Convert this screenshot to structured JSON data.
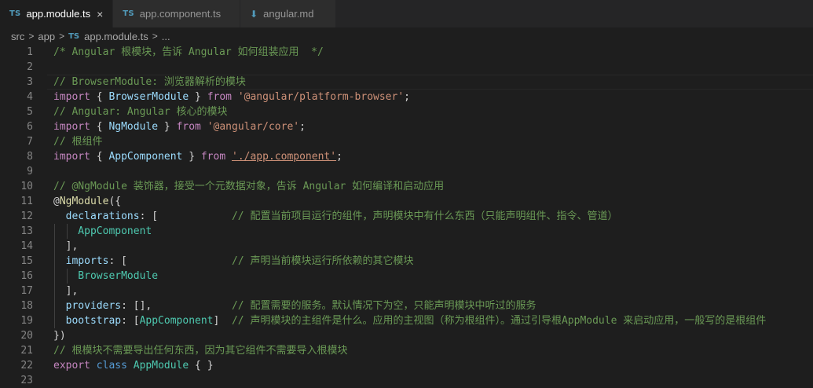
{
  "tabs": [
    {
      "icon": "TS",
      "label": "app.module.ts",
      "close": "×",
      "active": true
    },
    {
      "icon": "TS",
      "label": "app.component.ts",
      "active": false
    },
    {
      "icon": "⬇",
      "label": "angular.md",
      "active": false
    }
  ],
  "breadcrumb": {
    "parts": [
      "src",
      "app"
    ],
    "file_icon": "TS",
    "file": "app.module.ts",
    "more": "...",
    "sep": ">"
  },
  "editor": {
    "lines": [
      {
        "n": "1",
        "tokens": [
          {
            "t": "/* Angular 根模块，告诉 Angular 如何组装应用  */",
            "c": "c"
          }
        ]
      },
      {
        "n": "2",
        "tokens": []
      },
      {
        "n": "3",
        "tokens": [
          {
            "t": "// BrowserModule: 浏览器解析的模块",
            "c": "c"
          }
        ]
      },
      {
        "n": "4",
        "tokens": [
          {
            "t": "import",
            "c": "k"
          },
          {
            "t": " { ",
            "c": "p"
          },
          {
            "t": "BrowserModule",
            "c": "v"
          },
          {
            "t": " } ",
            "c": "p"
          },
          {
            "t": "from",
            "c": "k"
          },
          {
            "t": " ",
            "c": "p"
          },
          {
            "t": "'@angular/platform-browser'",
            "c": "s"
          },
          {
            "t": ";",
            "c": "p"
          }
        ]
      },
      {
        "n": "5",
        "tokens": [
          {
            "t": "// Angular: Angular 核心的模块",
            "c": "c"
          }
        ]
      },
      {
        "n": "6",
        "tokens": [
          {
            "t": "import",
            "c": "k"
          },
          {
            "t": " { ",
            "c": "p"
          },
          {
            "t": "NgModule",
            "c": "v"
          },
          {
            "t": " } ",
            "c": "p"
          },
          {
            "t": "from",
            "c": "k"
          },
          {
            "t": " ",
            "c": "p"
          },
          {
            "t": "'@angular/core'",
            "c": "s"
          },
          {
            "t": ";",
            "c": "p"
          }
        ]
      },
      {
        "n": "7",
        "tokens": [
          {
            "t": "// 根组件",
            "c": "c"
          }
        ]
      },
      {
        "n": "8",
        "tokens": [
          {
            "t": "import",
            "c": "k"
          },
          {
            "t": " { ",
            "c": "p"
          },
          {
            "t": "AppComponent",
            "c": "v"
          },
          {
            "t": " } ",
            "c": "p"
          },
          {
            "t": "from",
            "c": "k"
          },
          {
            "t": " ",
            "c": "p"
          },
          {
            "t": "'./app.component'",
            "c": "s u"
          },
          {
            "t": ";",
            "c": "p"
          }
        ]
      },
      {
        "n": "9",
        "tokens": []
      },
      {
        "n": "10",
        "tokens": [
          {
            "t": "// @NgModule 装饰器，接受一个元数据对象，告诉 Angular 如何编译和启动应用",
            "c": "c"
          }
        ]
      },
      {
        "n": "11",
        "tokens": [
          {
            "t": "@",
            "c": "p"
          },
          {
            "t": "NgModule",
            "c": "dec"
          },
          {
            "t": "({",
            "c": "p"
          }
        ]
      },
      {
        "n": "12",
        "tokens": [
          {
            "t": "  declarations",
            "c": "v"
          },
          {
            "t": ": [            ",
            "c": "p"
          },
          {
            "t": "// 配置当前项目运行的组件，声明模块中有什么东西（只能声明组件、指令、管道）",
            "c": "c"
          }
        ]
      },
      {
        "n": "13",
        "tokens": [
          {
            "t": "    AppComponent",
            "c": "t"
          }
        ]
      },
      {
        "n": "14",
        "tokens": [
          {
            "t": "  ],",
            "c": "p"
          }
        ]
      },
      {
        "n": "15",
        "tokens": [
          {
            "t": "  imports",
            "c": "v"
          },
          {
            "t": ": [                 ",
            "c": "p"
          },
          {
            "t": "// 声明当前模块运行所依赖的其它模块",
            "c": "c"
          }
        ]
      },
      {
        "n": "16",
        "tokens": [
          {
            "t": "    BrowserModule",
            "c": "t"
          }
        ]
      },
      {
        "n": "17",
        "tokens": [
          {
            "t": "  ],",
            "c": "p"
          }
        ]
      },
      {
        "n": "18",
        "tokens": [
          {
            "t": "  providers",
            "c": "v"
          },
          {
            "t": ": [],             ",
            "c": "p"
          },
          {
            "t": "// 配置需要的服务。默认情况下为空，只能声明模块中听过的服务",
            "c": "c"
          }
        ]
      },
      {
        "n": "19",
        "tokens": [
          {
            "t": "  bootstrap",
            "c": "v"
          },
          {
            "t": ": [",
            "c": "p"
          },
          {
            "t": "AppComponent",
            "c": "t"
          },
          {
            "t": "]  ",
            "c": "p"
          },
          {
            "t": "// 声明模块的主组件是什么。应用的主视图（称为根组件）。通过引导根AppModule 来启动应用，一般写的是根组件",
            "c": "c"
          }
        ]
      },
      {
        "n": "20",
        "tokens": [
          {
            "t": "})",
            "c": "p"
          }
        ]
      },
      {
        "n": "21",
        "tokens": [
          {
            "t": "// 根模块不需要导出任何东西，因为其它组件不需要导入根模块",
            "c": "c"
          }
        ]
      },
      {
        "n": "22",
        "tokens": [
          {
            "t": "export",
            "c": "k"
          },
          {
            "t": " ",
            "c": "p"
          },
          {
            "t": "class",
            "c": "kw"
          },
          {
            "t": " ",
            "c": "p"
          },
          {
            "t": "AppModule",
            "c": "t"
          },
          {
            "t": " { }",
            "c": "p"
          }
        ]
      },
      {
        "n": "23",
        "tokens": []
      }
    ]
  }
}
